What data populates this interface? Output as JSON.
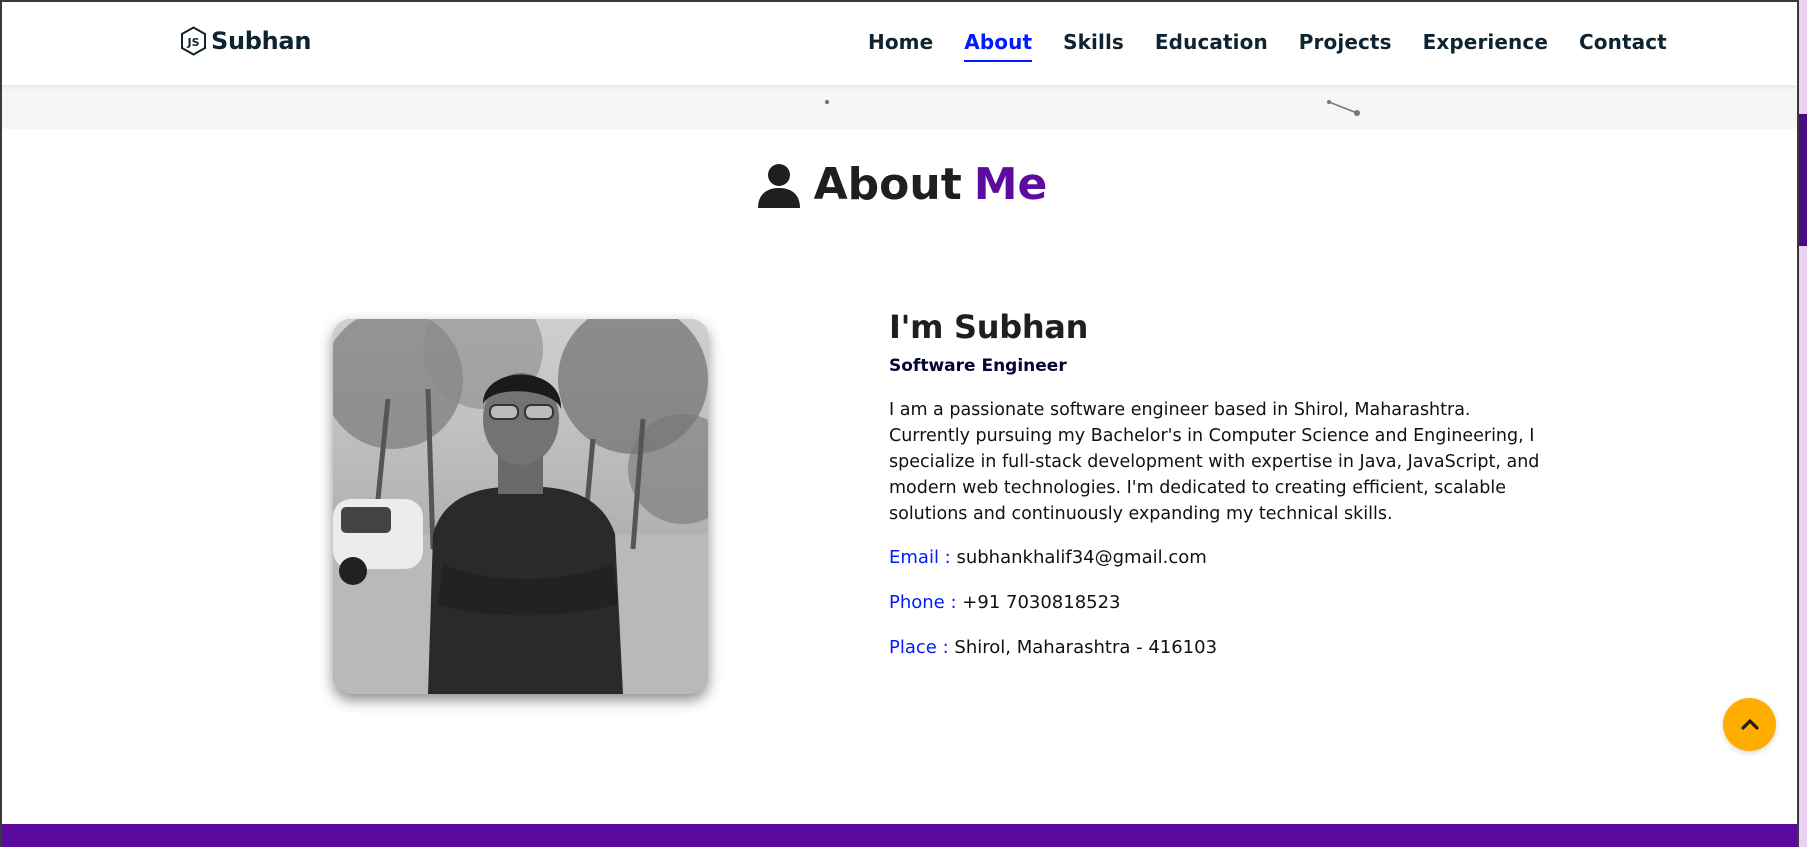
{
  "brand": {
    "name": "Subhan",
    "icon": "nodejs-hex-icon"
  },
  "nav": [
    {
      "label": "Home",
      "active": false
    },
    {
      "label": "About",
      "active": true
    },
    {
      "label": "Skills",
      "active": false
    },
    {
      "label": "Education",
      "active": false
    },
    {
      "label": "Projects",
      "active": false
    },
    {
      "label": "Experience",
      "active": false
    },
    {
      "label": "Contact",
      "active": false
    }
  ],
  "section": {
    "title_main": "About",
    "title_accent": "Me",
    "icon": "user-icon"
  },
  "profile": {
    "name": "I'm Subhan",
    "tag": "Software Engineer",
    "bio": "I am a passionate software engineer based in Shirol, Maharashtra. Currently pursuing my Bachelor's in Computer Science and Engineering, I specialize in full-stack development with expertise in Java, JavaScript, and modern web technologies. I'm dedicated to creating efficient, scalable solutions and continuously expanding my technical skills.",
    "email_label": "Email :",
    "email": "subhankhalif34@gmail.com",
    "phone_label": "Phone :",
    "phone": "+91 7030818523",
    "place_label": "Place :",
    "place": "Shirol, Maharashtra - 416103"
  },
  "scroll_top": {
    "icon": "chevron-up-icon"
  },
  "colors": {
    "accent_purple": "#5c0b9e",
    "link_blue": "#011aff",
    "text_dark": "#0e2431",
    "button_yellow": "#ffae00",
    "footer_purple": "#5a0a9e"
  }
}
